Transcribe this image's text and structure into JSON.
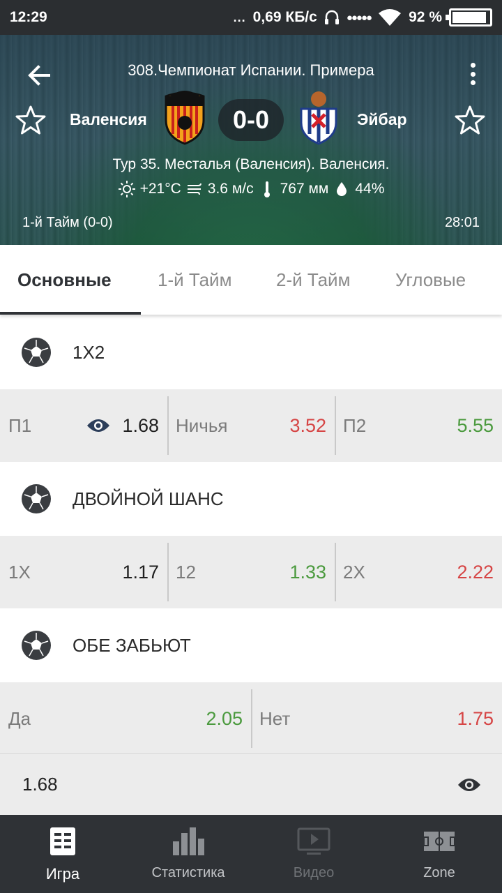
{
  "status_bar": {
    "time": "12:29",
    "dots": "...",
    "network_speed": "0,69 КБ/с",
    "battery": "92 %",
    "battery_level": 0.92
  },
  "header": {
    "league": "308.Чемпионат Испании. Примера",
    "home_team": "Валенсия",
    "away_team": "Эйбар",
    "score": "0-0",
    "venue": "Тур 35. Месталья (Валенсия). Валенсия.",
    "temperature": "+21°C",
    "wind": "3.6 м/с",
    "pressure": "767 мм",
    "humidity": "44%",
    "half": "1-й  Тайм (0-0)",
    "clock": "28:01",
    "icons": {
      "back": "back-arrow-icon",
      "menu": "more-vertical-icon",
      "favorite": "star-outline-icon"
    }
  },
  "tabs": [
    {
      "label": "Основные",
      "active": true
    },
    {
      "label": "1-й  Тайм",
      "active": false
    },
    {
      "label": "2-й  Тайм",
      "active": false
    },
    {
      "label": "Угловые",
      "active": false
    }
  ],
  "markets": [
    {
      "title": "1X2",
      "odds": [
        {
          "label": "П1",
          "value": "1.68",
          "color": "#1f1f1f"
        },
        {
          "label": "Ничья",
          "value": "3.52",
          "color": "#d64545"
        },
        {
          "label": "П2",
          "value": "5.55",
          "color": "#4b9a3e"
        }
      ]
    },
    {
      "title": "ДВОЙНОЙ ШАНС",
      "odds": [
        {
          "label": "1X",
          "value": "1.17",
          "color": "#1f1f1f"
        },
        {
          "label": "12",
          "value": "1.33",
          "color": "#4b9a3e"
        },
        {
          "label": "2X",
          "value": "2.22",
          "color": "#d64545"
        }
      ]
    },
    {
      "title": "ОБЕ ЗАБЬЮТ",
      "odds": [
        {
          "label": "Да",
          "value": "2.05",
          "color": "#4b9a3e"
        },
        {
          "label": "Нет",
          "value": "1.75",
          "color": "#d64545"
        }
      ]
    }
  ],
  "betslip": {
    "value": "1.68"
  },
  "bottom_nav": [
    {
      "label": "Игра",
      "icon": "game-list-icon",
      "state": "active"
    },
    {
      "label": "Статистика",
      "icon": "bar-chart-icon",
      "state": "normal"
    },
    {
      "label": "Видео",
      "icon": "video-play-icon",
      "state": "disabled"
    },
    {
      "label": "Zone",
      "icon": "field-zone-icon",
      "state": "normal"
    }
  ],
  "colors": {
    "nav_bg": "#2f3236",
    "odds_red": "#d64545",
    "odds_green": "#4b9a3e",
    "row_bg": "#ececec"
  }
}
